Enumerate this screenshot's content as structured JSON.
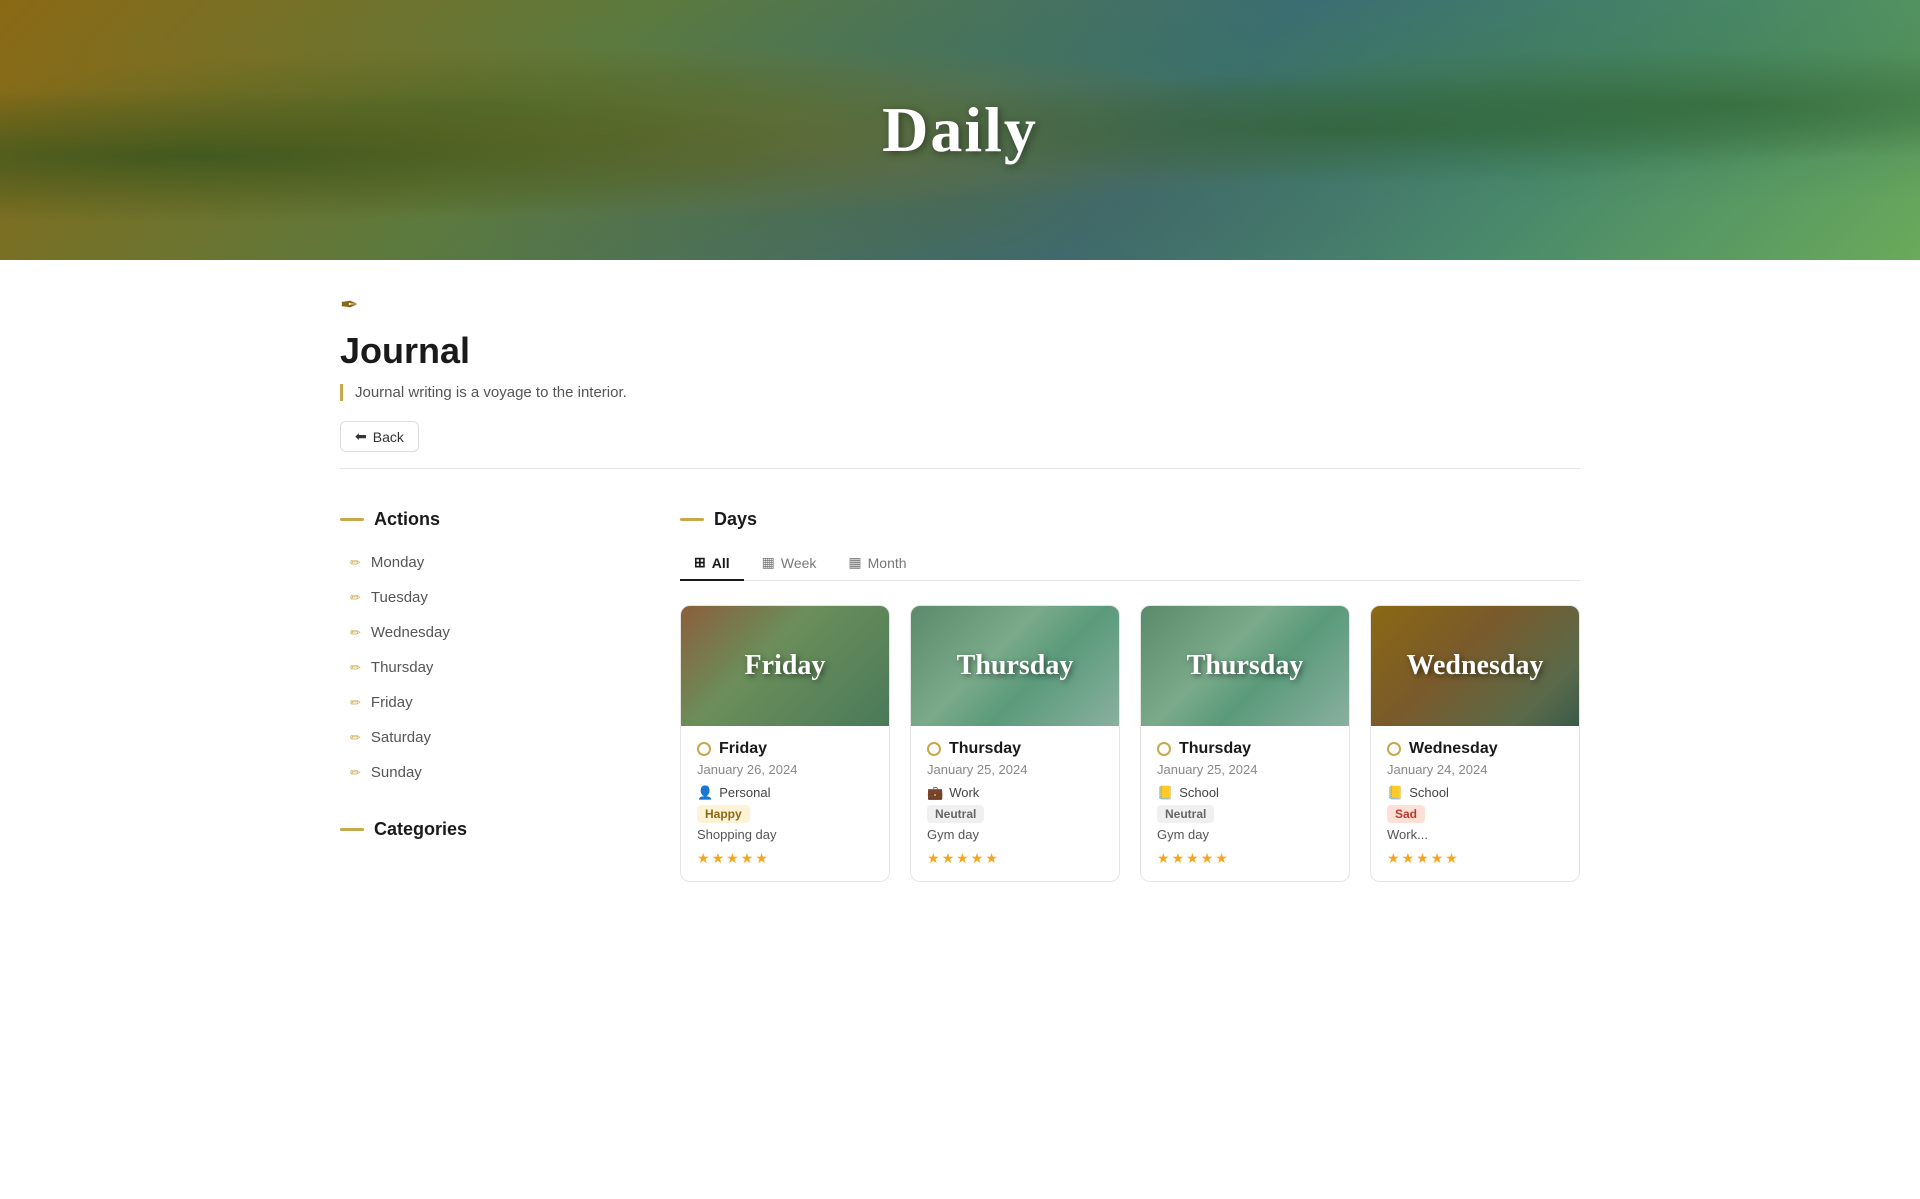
{
  "hero": {
    "title": "Daily"
  },
  "page": {
    "icon": "✒",
    "title": "Journal",
    "quote": "Journal writing is a voyage to the interior.",
    "back_label": "Back"
  },
  "sidebar": {
    "actions_label": "Actions",
    "days": [
      {
        "label": "Monday"
      },
      {
        "label": "Tuesday"
      },
      {
        "label": "Wednesday"
      },
      {
        "label": "Thursday"
      },
      {
        "label": "Friday"
      },
      {
        "label": "Saturday"
      },
      {
        "label": "Sunday"
      }
    ],
    "categories_label": "Categories"
  },
  "days_section": {
    "label": "Days",
    "tabs": [
      {
        "label": "All",
        "icon": "⊞",
        "active": true
      },
      {
        "label": "Week",
        "icon": "▦"
      },
      {
        "label": "Month",
        "icon": "▦"
      }
    ],
    "cards": [
      {
        "image_label": "Friday",
        "image_theme": "friday-1",
        "day": "Friday",
        "date": "January 26, 2024",
        "category_icon": "👤",
        "category": "Personal",
        "mood": "Happy",
        "mood_type": "happy",
        "description": "Shopping day",
        "stars": 5
      },
      {
        "image_label": "Thursday",
        "image_theme": "thursday-1",
        "day": "Thursday",
        "date": "January 25, 2024",
        "category_icon": "💼",
        "category": "Work",
        "mood": "Neutral",
        "mood_type": "neutral",
        "description": "Gym day",
        "stars": 5
      },
      {
        "image_label": "Thursday",
        "image_theme": "thursday-2",
        "day": "Thursday",
        "date": "January 25, 2024",
        "category_icon": "📒",
        "category": "School",
        "mood": "Neutral",
        "mood_type": "neutral",
        "description": "Gym day",
        "stars": 5
      },
      {
        "image_label": "Wednesday",
        "image_theme": "wednesday-1",
        "day": "Wednesday",
        "date": "January 24, 2024",
        "category_icon": "📒",
        "category": "School",
        "mood": "Sad",
        "mood_type": "sad",
        "description": "Work...",
        "stars": 5
      }
    ]
  }
}
